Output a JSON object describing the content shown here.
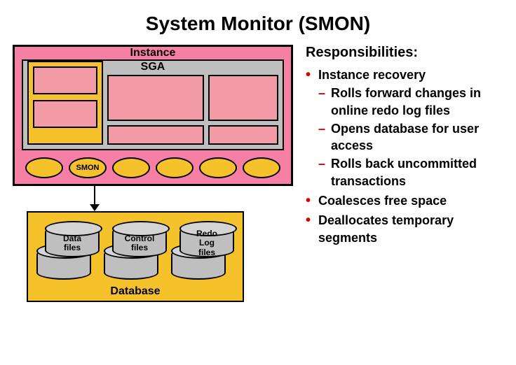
{
  "title": "System Monitor (SMON)",
  "diagram": {
    "instance_label": "Instance",
    "sga_label": "SGA",
    "smon_label": "SMON",
    "database_label": "Database",
    "cyl1": "Data\nfiles",
    "cyl2": "Control\nfiles",
    "cyl3": "Redo\nLog\nfiles"
  },
  "responsibilities": {
    "heading": "Responsibilities:",
    "items": [
      {
        "text": "Instance recovery",
        "sub": [
          "Rolls forward changes in online redo log files",
          "Opens database for user access",
          "Rolls back uncommitted transactions"
        ]
      },
      {
        "text": "Coalesces free space"
      },
      {
        "text": "Deallocates temporary segments"
      }
    ]
  }
}
